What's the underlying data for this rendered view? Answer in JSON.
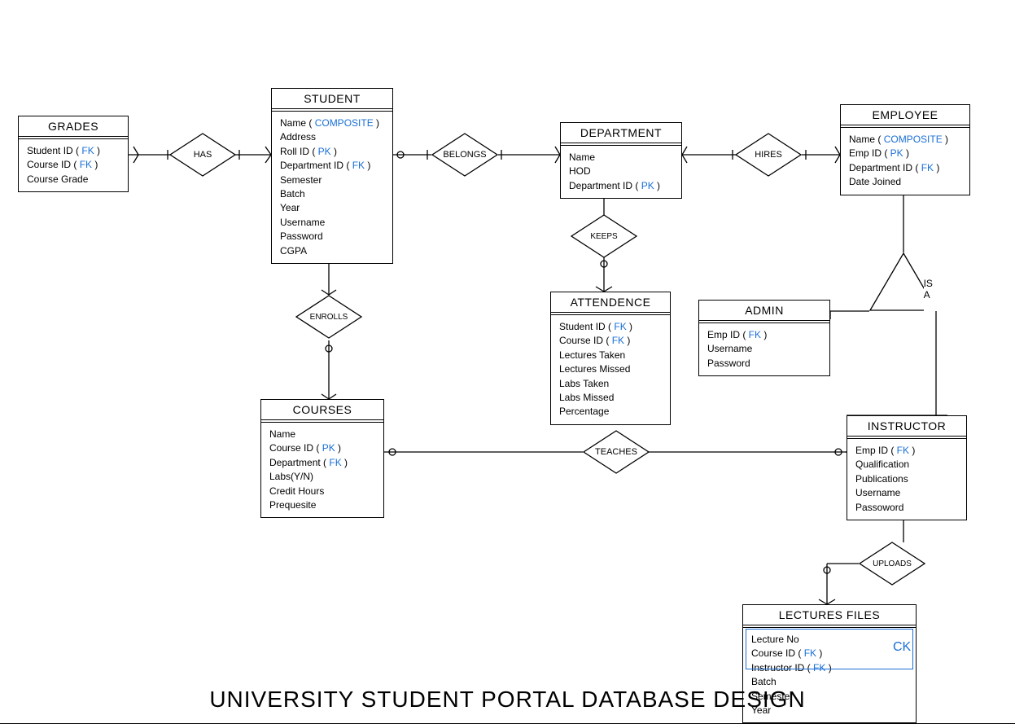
{
  "title": "UNIVERSITY STUDENT PORTAL DATABASE DESIGN",
  "keys": {
    "pk": "PK",
    "fk": "FK",
    "composite": "COMPOSITE",
    "ck": "CK"
  },
  "entities": {
    "grades": {
      "title": "GRADES",
      "attrs": [
        {
          "name": "Student ID",
          "key": "fk"
        },
        {
          "name": "Course ID",
          "key": "fk"
        },
        {
          "name": "Course Grade",
          "key": null
        }
      ]
    },
    "student": {
      "title": "STUDENT",
      "attrs": [
        {
          "name": "Name",
          "key": "composite"
        },
        {
          "name": "Address",
          "key": null
        },
        {
          "name": "Roll ID",
          "key": "pk"
        },
        {
          "name": "Department ID",
          "key": "fk"
        },
        {
          "name": "Semester",
          "key": null
        },
        {
          "name": "Batch",
          "key": null
        },
        {
          "name": "Year",
          "key": null
        },
        {
          "name": "Username",
          "key": null
        },
        {
          "name": "Password",
          "key": null
        },
        {
          "name": "CGPA",
          "key": null
        }
      ]
    },
    "department": {
      "title": "DEPARTMENT",
      "attrs": [
        {
          "name": "Name",
          "key": null
        },
        {
          "name": "HOD",
          "key": null
        },
        {
          "name": "Department ID",
          "key": "pk"
        }
      ]
    },
    "employee": {
      "title": "EMPLOYEE",
      "attrs": [
        {
          "name": "Name",
          "key": "composite"
        },
        {
          "name": "Emp ID",
          "key": "pk"
        },
        {
          "name": "Department ID",
          "key": "fk"
        },
        {
          "name": "Date Joined",
          "key": null
        }
      ]
    },
    "attendence": {
      "title": "ATTENDENCE",
      "attrs": [
        {
          "name": "Student ID",
          "key": "fk"
        },
        {
          "name": "Course ID",
          "key": "fk"
        },
        {
          "name": "Lectures Taken",
          "key": null
        },
        {
          "name": "Lectures Missed",
          "key": null
        },
        {
          "name": "Labs Taken",
          "key": null
        },
        {
          "name": "Labs Missed",
          "key": null
        },
        {
          "name": "Percentage",
          "key": null
        }
      ]
    },
    "admin": {
      "title": "ADMIN",
      "attrs": [
        {
          "name": "Emp ID",
          "key": "fk"
        },
        {
          "name": "Username",
          "key": null
        },
        {
          "name": "Password",
          "key": null
        }
      ]
    },
    "courses": {
      "title": "COURSES",
      "attrs": [
        {
          "name": "Name",
          "key": null
        },
        {
          "name": "Course ID",
          "key": "pk"
        },
        {
          "name": "Department",
          "key": "fk"
        },
        {
          "name": "Labs(Y/N)",
          "key": null
        },
        {
          "name": "Credit Hours",
          "key": null
        },
        {
          "name": "Prequesite",
          "key": null
        }
      ]
    },
    "instructor": {
      "title": "INSTRUCTOR",
      "attrs": [
        {
          "name": "Emp ID",
          "key": "fk"
        },
        {
          "name": "Qualification",
          "key": null
        },
        {
          "name": "Publications",
          "key": null
        },
        {
          "name": "Username",
          "key": null
        },
        {
          "name": "Passoword",
          "key": null
        }
      ]
    },
    "lectures_files": {
      "title": "LECTURES FILES",
      "attrs": [
        {
          "name": "Lecture No",
          "key": null
        },
        {
          "name": "Course ID",
          "key": "fk"
        },
        {
          "name": "Instructor ID",
          "key": "fk"
        },
        {
          "name": "Batch",
          "key": null
        },
        {
          "name": "Semester",
          "key": null
        },
        {
          "name": "Year",
          "key": null
        }
      ]
    }
  },
  "relationships": {
    "has": "HAS",
    "belongs": "BELONGS",
    "hires": "HIRES",
    "keeps": "KEEPS",
    "enrolls": "ENROLLS",
    "teaches": "TEACHES",
    "uploads": "UPLOADS",
    "isa": "IS A"
  }
}
